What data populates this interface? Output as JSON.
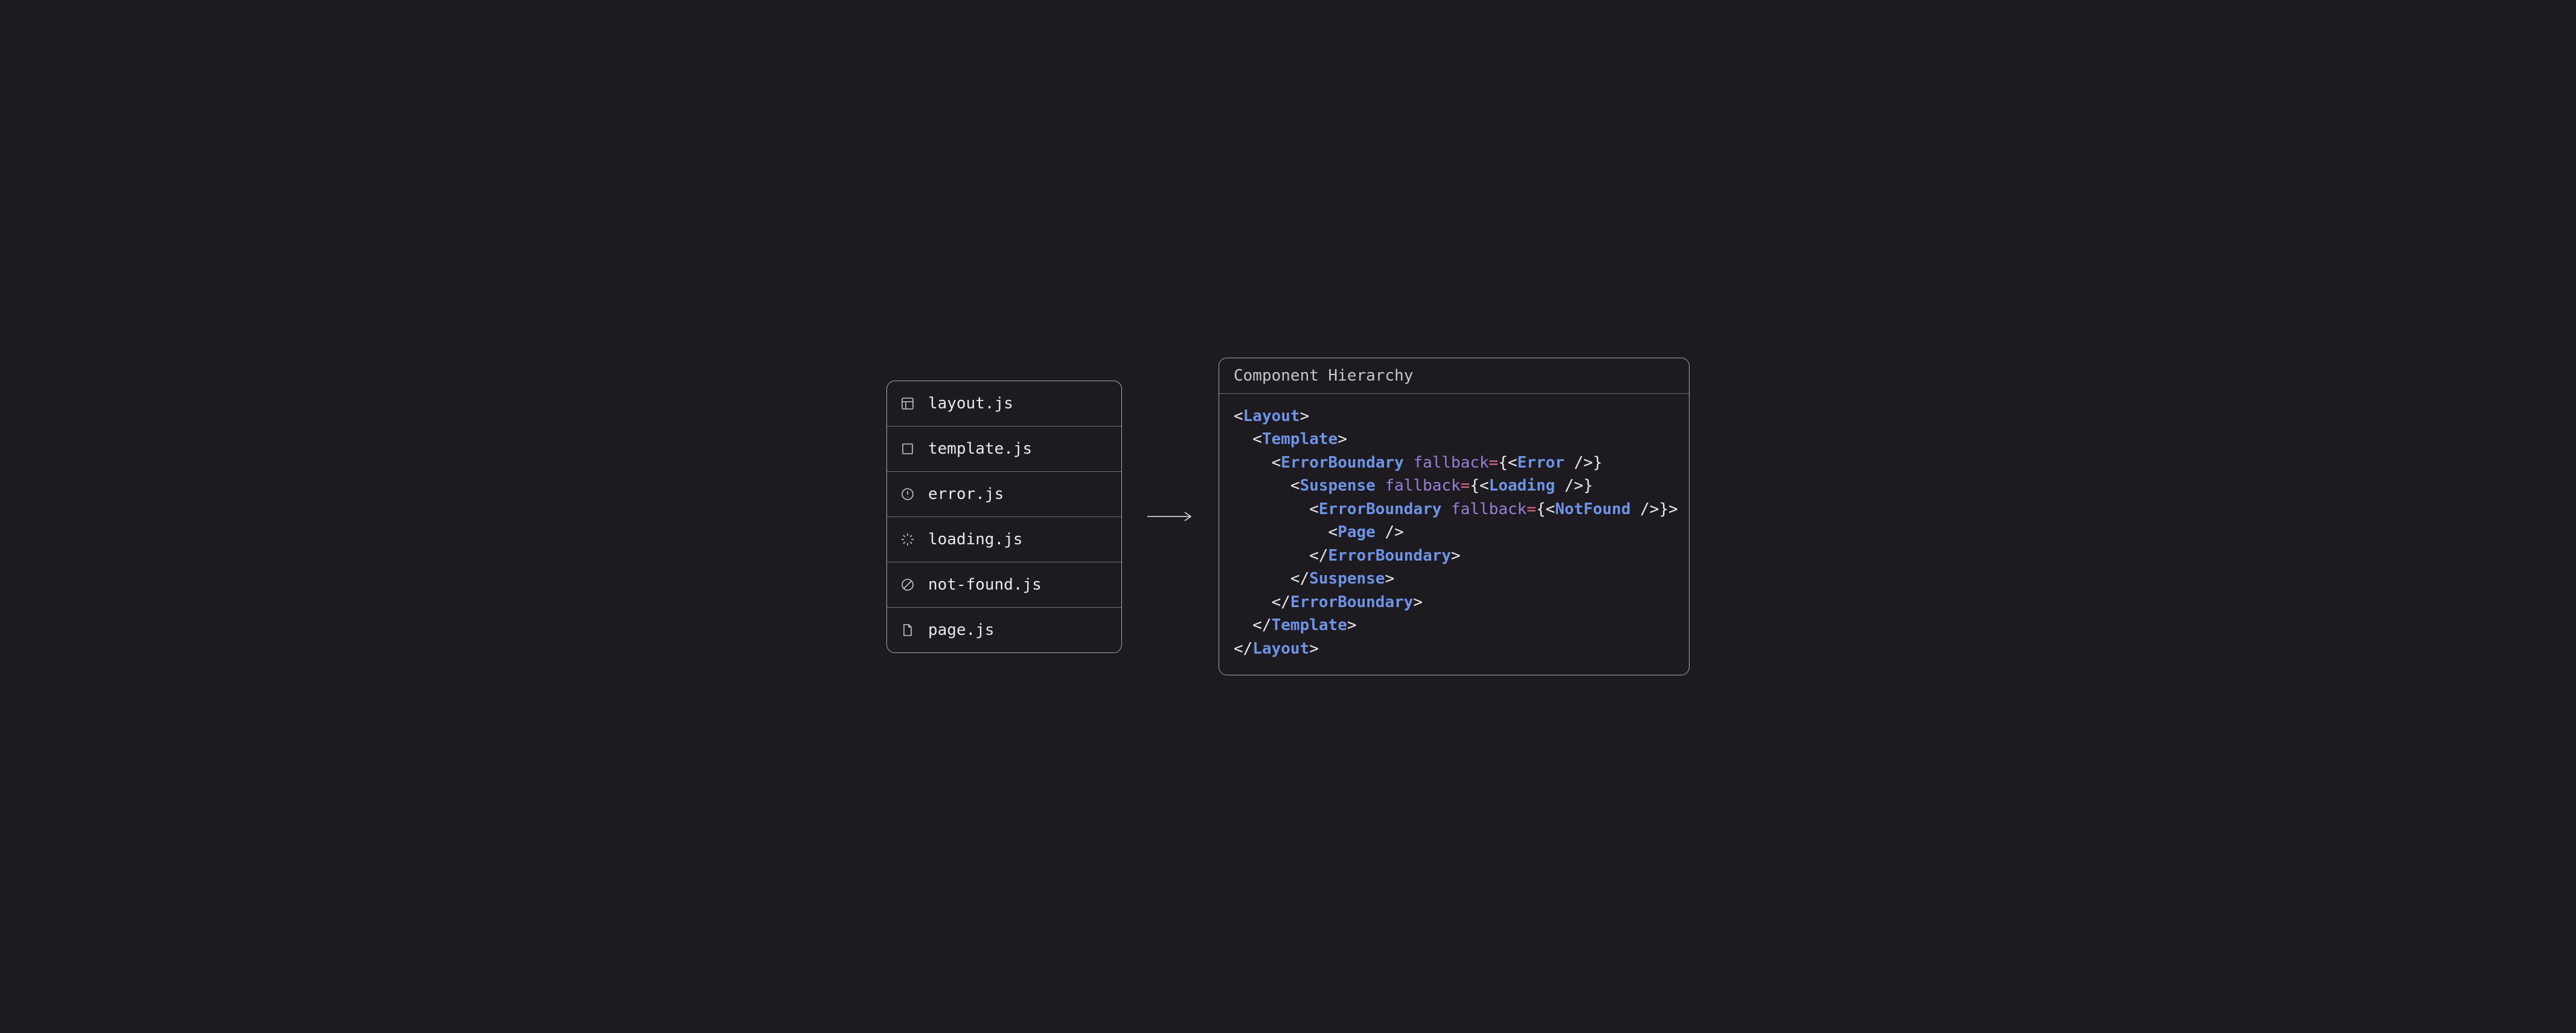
{
  "files": [
    {
      "icon": "layout-icon",
      "name": "layout.js"
    },
    {
      "icon": "square-icon",
      "name": "template.js"
    },
    {
      "icon": "alert-icon",
      "name": "error.js"
    },
    {
      "icon": "spinner-icon",
      "name": "loading.js"
    },
    {
      "icon": "forbidden-icon",
      "name": "not-found.js"
    },
    {
      "icon": "file-icon",
      "name": "page.js"
    }
  ],
  "code": {
    "title": "Component Hierarchy",
    "tokens": [
      [
        {
          "t": "<",
          "c": "punc"
        },
        {
          "t": "Layout",
          "c": "component"
        },
        {
          "t": ">",
          "c": "punc"
        }
      ],
      [
        {
          "t": "  <",
          "c": "punc"
        },
        {
          "t": "Template",
          "c": "component"
        },
        {
          "t": ">",
          "c": "punc"
        }
      ],
      [
        {
          "t": "    <",
          "c": "punc"
        },
        {
          "t": "ErrorBoundary",
          "c": "component"
        },
        {
          "t": " ",
          "c": "punc"
        },
        {
          "t": "fallback",
          "c": "attr"
        },
        {
          "t": "=",
          "c": "eq"
        },
        {
          "t": "{<",
          "c": "punc"
        },
        {
          "t": "Error",
          "c": "component"
        },
        {
          "t": " />}",
          "c": "punc"
        }
      ],
      [
        {
          "t": "      <",
          "c": "punc"
        },
        {
          "t": "Suspense",
          "c": "component"
        },
        {
          "t": " ",
          "c": "punc"
        },
        {
          "t": "fallback",
          "c": "attr"
        },
        {
          "t": "=",
          "c": "eq"
        },
        {
          "t": "{<",
          "c": "punc"
        },
        {
          "t": "Loading",
          "c": "component"
        },
        {
          "t": " />}",
          "c": "punc"
        }
      ],
      [
        {
          "t": "        <",
          "c": "punc"
        },
        {
          "t": "ErrorBoundary",
          "c": "component"
        },
        {
          "t": " ",
          "c": "punc"
        },
        {
          "t": "fallback",
          "c": "attr"
        },
        {
          "t": "=",
          "c": "eq"
        },
        {
          "t": "{<",
          "c": "punc"
        },
        {
          "t": "NotFound",
          "c": "component"
        },
        {
          "t": " />}>",
          "c": "punc"
        }
      ],
      [
        {
          "t": "          <",
          "c": "punc"
        },
        {
          "t": "Page",
          "c": "component"
        },
        {
          "t": " />",
          "c": "punc"
        }
      ],
      [
        {
          "t": "        </",
          "c": "punc"
        },
        {
          "t": "ErrorBoundary",
          "c": "component"
        },
        {
          "t": ">",
          "c": "punc"
        }
      ],
      [
        {
          "t": "      </",
          "c": "punc"
        },
        {
          "t": "Suspense",
          "c": "component"
        },
        {
          "t": ">",
          "c": "punc"
        }
      ],
      [
        {
          "t": "    </",
          "c": "punc"
        },
        {
          "t": "ErrorBoundary",
          "c": "component"
        },
        {
          "t": ">",
          "c": "punc"
        }
      ],
      [
        {
          "t": "  </",
          "c": "punc"
        },
        {
          "t": "Template",
          "c": "component"
        },
        {
          "t": ">",
          "c": "punc"
        }
      ],
      [
        {
          "t": "</",
          "c": "punc"
        },
        {
          "t": "Layout",
          "c": "component"
        },
        {
          "t": ">",
          "c": "punc"
        }
      ]
    ]
  }
}
